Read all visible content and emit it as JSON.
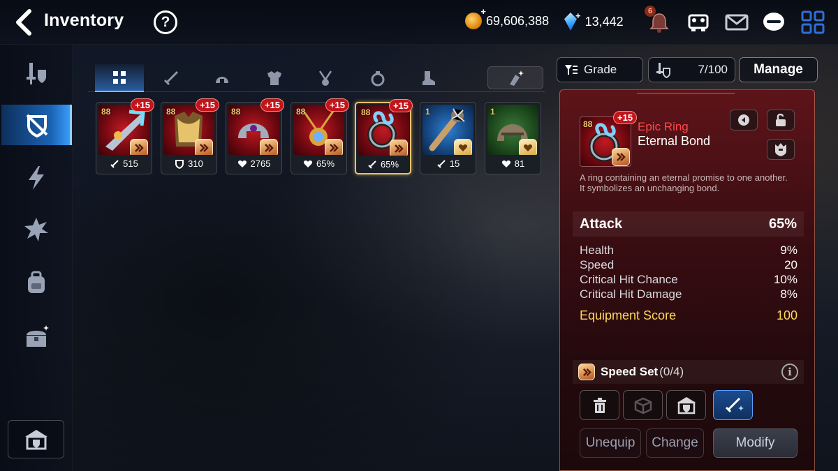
{
  "header": {
    "title": "Inventory",
    "help_label": "?",
    "gold": "69,606,388",
    "crystals": "13,442",
    "notification_count": "6",
    "plus": "+"
  },
  "tabs": [
    "all",
    "weapon",
    "helmet",
    "armor",
    "necklace",
    "ring",
    "boots"
  ],
  "toolbar": {
    "grade_label": "Grade",
    "capacity": "7/100",
    "manage_label": "Manage"
  },
  "items": [
    {
      "level": "88",
      "enhance": "+15",
      "stat_icon": "attack",
      "stat": "515",
      "rarity": "epic",
      "set_color": "orange",
      "kind": "weapon"
    },
    {
      "level": "88",
      "enhance": "+15",
      "stat_icon": "defense",
      "stat": "310",
      "rarity": "epic",
      "set_color": "orange",
      "kind": "armor"
    },
    {
      "level": "88",
      "enhance": "+15",
      "stat_icon": "health",
      "stat": "2765",
      "rarity": "epic",
      "set_color": "orange",
      "kind": "helmet"
    },
    {
      "level": "88",
      "enhance": "+15",
      "stat_icon": "health",
      "stat": "65%",
      "rarity": "epic",
      "set_color": "orange",
      "kind": "necklace"
    },
    {
      "level": "88",
      "enhance": "+15",
      "stat_icon": "attack",
      "stat": "65%",
      "rarity": "epic",
      "set_color": "orange",
      "kind": "ring",
      "selected": true
    },
    {
      "level": "1",
      "enhance": "",
      "stat_icon": "attack",
      "stat": "15",
      "rarity": "rare",
      "set_color": "gold",
      "kind": "weapon"
    },
    {
      "level": "1",
      "enhance": "",
      "stat_icon": "health",
      "stat": "81",
      "rarity": "uncommon",
      "set_color": "gold",
      "kind": "helmet"
    }
  ],
  "detail": {
    "level": "88",
    "enhance": "+15",
    "rarity": "Epic Ring",
    "name": "Eternal Bond",
    "description_1": "A ring containing an eternal promise to one another.",
    "description_2": "It symbolizes an unchanging bond.",
    "main_stat": {
      "name": "Attack",
      "value": "65%"
    },
    "sub_stats": [
      {
        "name": "Health",
        "value": "9%"
      },
      {
        "name": "Speed",
        "value": "20"
      },
      {
        "name": "Critical Hit Chance",
        "value": "10%"
      },
      {
        "name": "Critical Hit Damage",
        "value": "8%"
      }
    ],
    "score": {
      "name": "Equipment Score",
      "value": "100"
    },
    "set": {
      "name": "Speed Set",
      "count": "(0/4)"
    },
    "info_label": "i",
    "buttons": {
      "unequip": "Unequip",
      "change": "Change",
      "modify": "Modify"
    }
  },
  "colors": {
    "epic": "#c21a23",
    "rare": "#2f7fd0",
    "uncommon": "#3c7a3a",
    "accent_blue": "#3ca3ff",
    "score_yellow": "#ffd95a",
    "rarity_red": "#ff4a4a"
  }
}
